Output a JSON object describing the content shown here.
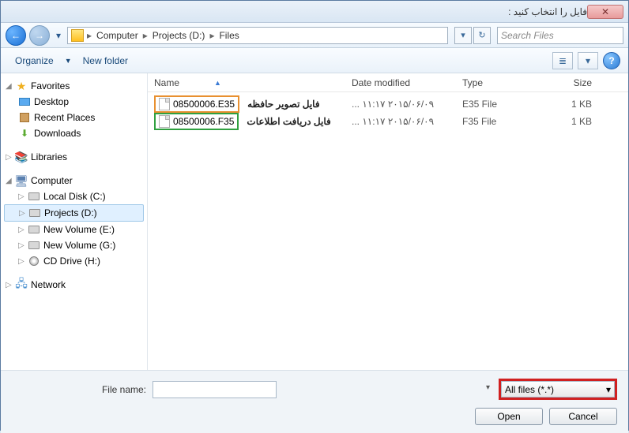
{
  "title": "فایل را انتخاب کنید :",
  "breadcrumb": [
    "Computer",
    "Projects (D:)",
    "Files"
  ],
  "search_placeholder": "Search Files",
  "toolbar": {
    "organize": "Organize",
    "newfolder": "New folder"
  },
  "columns": {
    "name": "Name",
    "date": "Date modified",
    "type": "Type",
    "size": "Size"
  },
  "sidebar": {
    "favorites": {
      "label": "Favorites",
      "items": [
        "Desktop",
        "Recent Places",
        "Downloads"
      ]
    },
    "libraries": {
      "label": "Libraries"
    },
    "computer": {
      "label": "Computer",
      "items": [
        "Local Disk (C:)",
        "Projects (D:)",
        "New Volume (E:)",
        "New Volume (G:)",
        "CD Drive (H:)"
      ]
    },
    "network": {
      "label": "Network"
    }
  },
  "files": [
    {
      "name": "08500006.E35",
      "date": "۲۰۱۵/۰۶/۰۹ ۱۱:۱۷ ...",
      "type": "E35 File",
      "size": "1 KB",
      "annot": "فایل تصویر حافظه",
      "hl": "orange"
    },
    {
      "name": "08500006.F35",
      "date": "۲۰۱۵/۰۶/۰۹ ۱۱:۱۷ ...",
      "type": "F35 File",
      "size": "1 KB",
      "annot": "فایل دریافت اطلاعات",
      "hl": "green"
    }
  ],
  "filename_label": "File name:",
  "filter": "All files (*.*)",
  "buttons": {
    "open": "Open",
    "cancel": "Cancel"
  }
}
